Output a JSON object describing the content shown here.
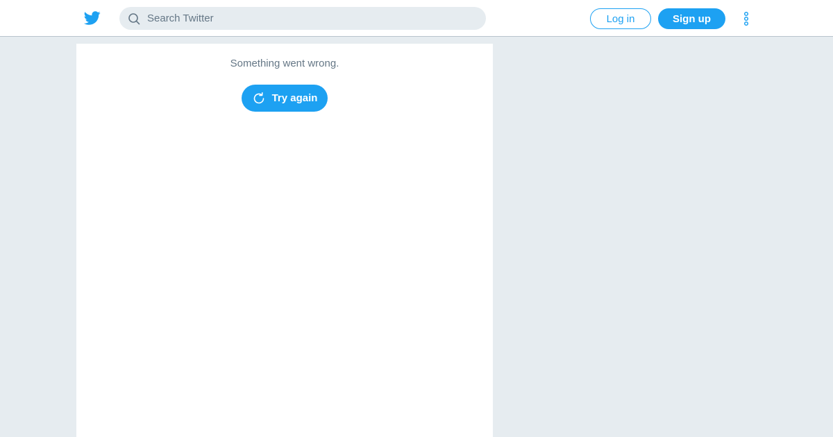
{
  "header": {
    "logo_icon": "twitter-bird-icon",
    "search": {
      "icon": "search-icon",
      "placeholder": "Search Twitter",
      "value": ""
    },
    "login_label": "Log in",
    "signup_label": "Sign up",
    "more_icon": "more-vertical-icon"
  },
  "main": {
    "error_message": "Something went wrong.",
    "retry_label": "Try again",
    "retry_icon": "refresh-icon"
  },
  "colors": {
    "brand": "#1da1f2",
    "background": "#e6ecf0",
    "secondary_text": "#657786"
  }
}
